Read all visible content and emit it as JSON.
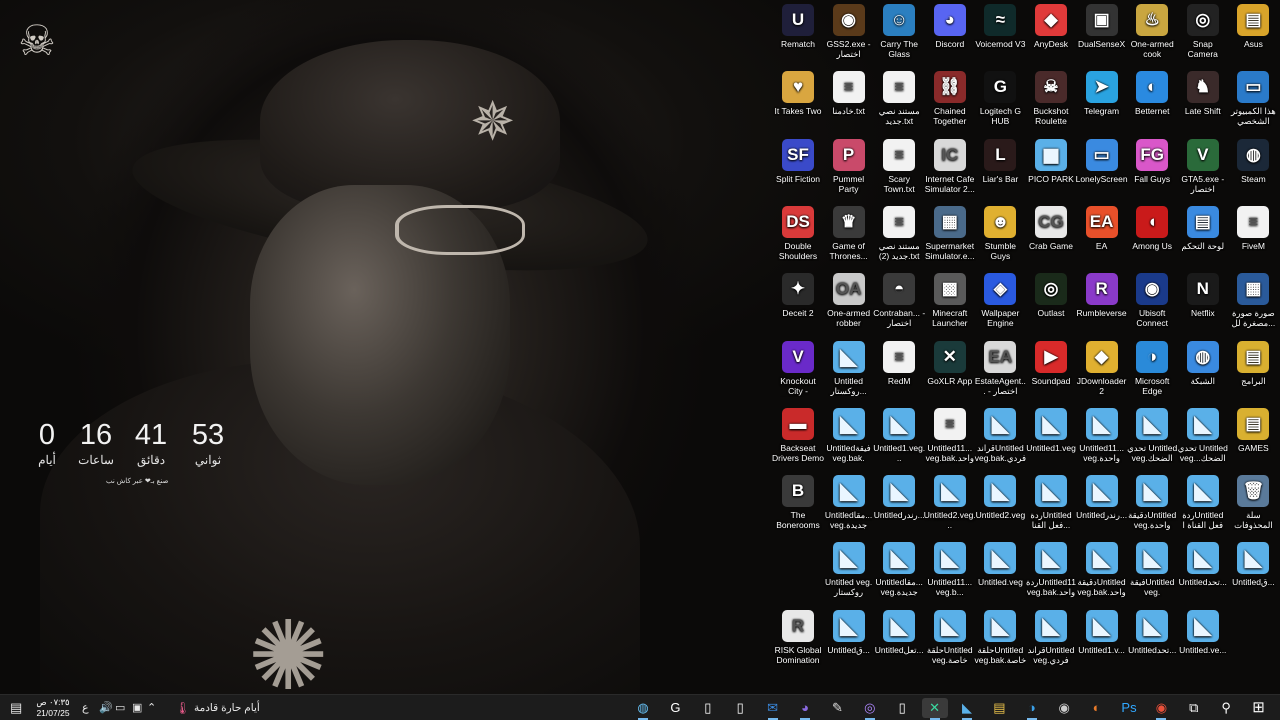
{
  "countdown": {
    "days": {
      "value": "0",
      "label": "أيام"
    },
    "hours": {
      "value": "16",
      "label": "ساعات"
    },
    "minutes": {
      "value": "41",
      "label": "دقائق"
    },
    "seconds": {
      "value": "53",
      "label": "ثواني"
    },
    "caption": "صنع بـ❤ عبر كاش نب"
  },
  "desktop_icons": [
    {
      "label": "Rematch",
      "glyph": "U",
      "color": "#1f1f3a"
    },
    {
      "label": "GSS2.exe - اختصار",
      "glyph": "◉",
      "color": "#5a3a1a"
    },
    {
      "label": "Carry The Glass",
      "glyph": "☺",
      "color": "#2b7fc0"
    },
    {
      "label": "Discord",
      "glyph": "◕",
      "color": "#5865f2"
    },
    {
      "label": "Voicemod V3",
      "glyph": "≈",
      "color": "#0f2a2a"
    },
    {
      "label": "AnyDesk",
      "glyph": "◆",
      "color": "#e03a3a"
    },
    {
      "label": "DualSenseX",
      "glyph": "▣",
      "color": "#333333"
    },
    {
      "label": "One-armed cook",
      "glyph": "♨",
      "color": "#c9a640"
    },
    {
      "label": "Snap Camera",
      "glyph": "◎",
      "color": "#222222"
    },
    {
      "label": "Asus",
      "glyph": "▤",
      "color": "#d9a42a"
    },
    {
      "label": "It Takes Two",
      "glyph": "♥",
      "color": "#d9a640"
    },
    {
      "label": "خادمنا.txt",
      "glyph": "≡",
      "color": "#f2f2f2"
    },
    {
      "label": "مستند نصي جديد.txt",
      "glyph": "≡",
      "color": "#f2f2f2"
    },
    {
      "label": "Chained Together",
      "glyph": "⛓",
      "color": "#8a2a2a"
    },
    {
      "label": "Logitech G HUB",
      "glyph": "G",
      "color": "#111111"
    },
    {
      "label": "Buckshot Roulette",
      "glyph": "☠",
      "color": "#4a2a2a"
    },
    {
      "label": "Telegram",
      "glyph": "➤",
      "color": "#2aa3e0"
    },
    {
      "label": "Betternet",
      "glyph": "◐",
      "color": "#2a8ae0"
    },
    {
      "label": "Late Shift",
      "glyph": "♞",
      "color": "#3a2a2a"
    },
    {
      "label": "هذا الكمبيوتر الشخصي",
      "glyph": "▭",
      "color": "#2a7ac9"
    },
    {
      "label": "Split Fiction",
      "glyph": "SF",
      "color": "#3a4ac9"
    },
    {
      "label": "Pummel Party",
      "glyph": "P",
      "color": "#c94a6a"
    },
    {
      "label": "Scary Town.txt",
      "glyph": "≡",
      "color": "#f2f2f2"
    },
    {
      "label": "Internet Cafe Simulator 2...",
      "glyph": "IC",
      "color": "#d9d9d9"
    },
    {
      "label": "Liar's Bar",
      "glyph": "L",
      "color": "#2a1a1a"
    },
    {
      "label": "PICO PARK",
      "glyph": "◼",
      "color": "#5ab0e8"
    },
    {
      "label": "LonelyScreen",
      "glyph": "▭",
      "color": "#3a8ae0"
    },
    {
      "label": "Fall Guys",
      "glyph": "FG",
      "color": "#d957c9"
    },
    {
      "label": "GTA5.exe - اختصار",
      "glyph": "V",
      "color": "#2a6a3a"
    },
    {
      "label": "Steam",
      "glyph": "◍",
      "color": "#1b2838"
    },
    {
      "label": "Double Shoulders",
      "glyph": "DS",
      "color": "#d93a3a"
    },
    {
      "label": "Game of Thrones...",
      "glyph": "♛",
      "color": "#3a3a3a"
    },
    {
      "label": "مستند نصي جديد (2).txt",
      "glyph": "≡",
      "color": "#f2f2f2"
    },
    {
      "label": "Supermarket Simulator.e...",
      "glyph": "▦",
      "color": "#4a6a8a"
    },
    {
      "label": "Stumble Guys",
      "glyph": "☻",
      "color": "#e0b030"
    },
    {
      "label": "Crab Game",
      "glyph": "CG",
      "color": "#e8e8e8"
    },
    {
      "label": "EA",
      "glyph": "EA",
      "color": "#e8502a"
    },
    {
      "label": "Among Us",
      "glyph": "◖",
      "color": "#c91a1a"
    },
    {
      "label": "لوحة التحكم",
      "glyph": "▤",
      "color": "#3a8ae0"
    },
    {
      "label": "FiveM",
      "glyph": "≡",
      "color": "#f2f2f2"
    },
    {
      "label": "Deceit 2",
      "glyph": "✦",
      "color": "#2a2a2a"
    },
    {
      "label": "One-armed robber",
      "glyph": "OA",
      "color": "#c9c9c9"
    },
    {
      "label": "Contraban... - اختصار",
      "glyph": "◓",
      "color": "#3a3a3a"
    },
    {
      "label": "Minecraft Launcher",
      "glyph": "▩",
      "color": "#5a5a5a"
    },
    {
      "label": "Wallpaper Engine",
      "glyph": "◈",
      "color": "#2a5ae0"
    },
    {
      "label": "Outlast",
      "glyph": "◎",
      "color": "#1a2a1a"
    },
    {
      "label": "Rumbleverse",
      "glyph": "R",
      "color": "#8a3ac9"
    },
    {
      "label": "Ubisoft Connect",
      "glyph": "◉",
      "color": "#1a3a8a"
    },
    {
      "label": "Netflix",
      "glyph": "N",
      "color": "#1a1a1a"
    },
    {
      "label": "صورة صورة مصغرة لل...",
      "glyph": "▦",
      "color": "#2a5a9a"
    },
    {
      "label": "Knockout City - Private...",
      "glyph": "V",
      "color": "#6a2ac9"
    },
    {
      "label": "Untitled روكستار...",
      "glyph": "◣",
      "color": "#5ab0e8"
    },
    {
      "label": "RedM",
      "glyph": "≡",
      "color": "#f2f2f2"
    },
    {
      "label": "GoXLR App",
      "glyph": "✕",
      "color": "#1a3a3a"
    },
    {
      "label": "EstateAgent... - اختصار",
      "glyph": "EA",
      "color": "#d9d9d9"
    },
    {
      "label": "Soundpad",
      "glyph": "▶",
      "color": "#d92a2a"
    },
    {
      "label": "JDownloader 2",
      "glyph": "◆",
      "color": "#e0b030"
    },
    {
      "label": "Microsoft Edge",
      "glyph": "◑",
      "color": "#2a8ad9"
    },
    {
      "label": "الشبكة",
      "glyph": "◍",
      "color": "#3a8ae0"
    },
    {
      "label": "البرامج",
      "glyph": "▤",
      "color": "#d9b030"
    },
    {
      "label": "Backseat Drivers Demo",
      "glyph": "▬",
      "color": "#c92a2a"
    },
    {
      "label": "Untitledفيقة veg.bak.",
      "glyph": "◣",
      "color": "#5ab0e8"
    },
    {
      "label": "Untitled1.veg...",
      "glyph": "◣",
      "color": "#5ab0e8"
    },
    {
      "label": "Untitled11... veg.bak.واحدة",
      "glyph": "≡",
      "color": "#f2f2f2"
    },
    {
      "label": "قراندUntitled veg.bak.فردي",
      "glyph": "◣",
      "color": "#5ab0e8"
    },
    {
      "label": "Untitled1.veg",
      "glyph": "◣",
      "color": "#5ab0e8"
    },
    {
      "label": "Untitled11... veg.واحدة",
      "glyph": "◣",
      "color": "#5ab0e8"
    },
    {
      "label": "تحدي Untitled veg.الضحك",
      "glyph": "◣",
      "color": "#5ab0e8"
    },
    {
      "label": "تحدي Untitled veg...الضحك",
      "glyph": "◣",
      "color": "#5ab0e8"
    },
    {
      "label": "GAMES",
      "glyph": "▤",
      "color": "#d9b030"
    },
    {
      "label": "The Bonerooms",
      "glyph": "B",
      "color": "#3a3a3a"
    },
    {
      "label": "Untitledمقا... veg.جديدة",
      "glyph": "◣",
      "color": "#5ab0e8"
    },
    {
      "label": "Untitledرندر...",
      "glyph": "◣",
      "color": "#5ab0e8"
    },
    {
      "label": "Untitled2.veg...",
      "glyph": "◣",
      "color": "#5ab0e8"
    },
    {
      "label": "Untitled2.veg",
      "glyph": "◣",
      "color": "#5ab0e8"
    },
    {
      "label": "ردةUntitled فعل القنا...",
      "glyph": "◣",
      "color": "#5ab0e8"
    },
    {
      "label": "Untitledرندر...",
      "glyph": "◣",
      "color": "#5ab0e8"
    },
    {
      "label": "دقيقةUntitled veg.واحدة",
      "glyph": "◣",
      "color": "#5ab0e8"
    },
    {
      "label": "ردةUntitled فعل القناة ا",
      "glyph": "◣",
      "color": "#5ab0e8"
    },
    {
      "label": "سلة المحذوفات",
      "glyph": "🗑",
      "color": "#5a7a9a"
    },
    {
      "label": "",
      "glyph": "",
      "color": "transparent"
    },
    {
      "label": "Untitled veg. روكستار",
      "glyph": "◣",
      "color": "#5ab0e8"
    },
    {
      "label": "Untitledمقا... veg.جديدة",
      "glyph": "◣",
      "color": "#5ab0e8"
    },
    {
      "label": "Untitled11... veg.b...",
      "glyph": "◣",
      "color": "#5ab0e8"
    },
    {
      "label": "Untitled.veg",
      "glyph": "◣",
      "color": "#5ab0e8"
    },
    {
      "label": "ردةUntitled11 veg.bak.واحدة",
      "glyph": "◣",
      "color": "#5ab0e8"
    },
    {
      "label": "دقيقةUntitled veg.bak.واحدة",
      "glyph": "◣",
      "color": "#5ab0e8"
    },
    {
      "label": "فيقةUntitled veg.",
      "glyph": "◣",
      "color": "#5ab0e8"
    },
    {
      "label": "Untitledتحد...",
      "glyph": "◣",
      "color": "#5ab0e8"
    },
    {
      "label": "Untitledق...",
      "glyph": "◣",
      "color": "#5ab0e8"
    },
    {
      "label": "RISK Global Domination",
      "glyph": "R",
      "color": "#e8e8e8"
    },
    {
      "label": "Untitledق...",
      "glyph": "◣",
      "color": "#5ab0e8"
    },
    {
      "label": "Untitledتعل...",
      "glyph": "◣",
      "color": "#5ab0e8"
    },
    {
      "label": "حلقةUntitled veg.خاصة",
      "glyph": "◣",
      "color": "#5ab0e8"
    },
    {
      "label": "حلقةUntitled veg.bak.خاصة",
      "glyph": "◣",
      "color": "#5ab0e8"
    },
    {
      "label": "قراندUntitled veg.فردي",
      "glyph": "◣",
      "color": "#5ab0e8"
    },
    {
      "label": "Untitled1.v...",
      "glyph": "◣",
      "color": "#5ab0e8"
    },
    {
      "label": "Untitledتحد...",
      "glyph": "◣",
      "color": "#5ab0e8"
    },
    {
      "label": "Untitled.ve...",
      "glyph": "◣",
      "color": "#5ab0e8"
    }
  ],
  "taskbar": {
    "clock_time": "٠٧:٣٥ ص",
    "clock_date": "21/07/25",
    "lang": "ع",
    "weather_text": "أيام حارة قادمة",
    "apps": [
      {
        "name": "steam",
        "glyph": "◍",
        "color": "#66c0f4"
      },
      {
        "name": "logitech-g-hub",
        "glyph": "G",
        "color": "#ffffff"
      },
      {
        "name": "text-file",
        "glyph": "▯",
        "color": "#ffffff"
      },
      {
        "name": "text-file",
        "glyph": "▯",
        "color": "#ffffff"
      },
      {
        "name": "outlook",
        "glyph": "✉",
        "color": "#3a8ae0"
      },
      {
        "name": "discord-bug",
        "glyph": "◕",
        "color": "#8a6ae0"
      },
      {
        "name": "notepad",
        "glyph": "✎",
        "color": "#dddddd"
      },
      {
        "name": "obs",
        "glyph": "◎",
        "color": "#b088ff"
      },
      {
        "name": "text-file",
        "glyph": "▯",
        "color": "#ffffff"
      },
      {
        "name": "goxlr",
        "glyph": "✕",
        "color": "#3ad9a0"
      },
      {
        "name": "vegas",
        "glyph": "◣",
        "color": "#5ab0e8"
      },
      {
        "name": "file-explorer",
        "glyph": "▤",
        "color": "#e8c04a"
      },
      {
        "name": "edge",
        "glyph": "◑",
        "color": "#3aa0e8"
      },
      {
        "name": "gamepad",
        "glyph": "◉",
        "color": "#cccccc"
      },
      {
        "name": "firefox",
        "glyph": "◐",
        "color": "#e87a2a"
      },
      {
        "name": "photoshop",
        "glyph": "Ps",
        "color": "#31a8ff"
      },
      {
        "name": "chrome",
        "glyph": "◉",
        "color": "#e8503a"
      },
      {
        "name": "task-view",
        "glyph": "⧉",
        "color": "#ffffff"
      },
      {
        "name": "search",
        "glyph": "⚲",
        "color": "#ffffff"
      },
      {
        "name": "start",
        "glyph": "⊞",
        "color": "#ffffff"
      }
    ]
  }
}
